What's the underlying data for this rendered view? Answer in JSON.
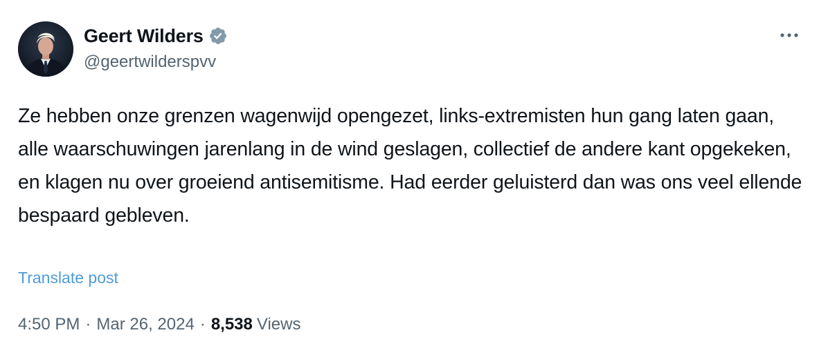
{
  "author": {
    "display_name": "Geert Wilders",
    "handle": "@geertwilderspvv",
    "verified": true,
    "avatar_icon": "profile-photo"
  },
  "post": {
    "text": "Ze hebben onze grenzen wagenwijd opengezet, links-extremisten hun gang laten gaan, alle waarschuwingen jarenlang in de wind geslagen, collectief de andere kant opgekeken, en klagen nu over groeiend antisemitisme. Had eerder geluisterd dan was ons veel ellende bespaard gebleven.",
    "translate_label": "Translate post",
    "time": "4:50 PM",
    "date": "Mar 26, 2024",
    "views_count": "8,538",
    "views_label": "Views",
    "separator": "·"
  },
  "colors": {
    "text_primary": "#0f1419",
    "text_secondary": "#536471",
    "link": "#4f9bd8",
    "verified_badge": "#829aab"
  },
  "icons": {
    "verified": "verified-badge-icon",
    "more": "more-horizontal-icon"
  }
}
